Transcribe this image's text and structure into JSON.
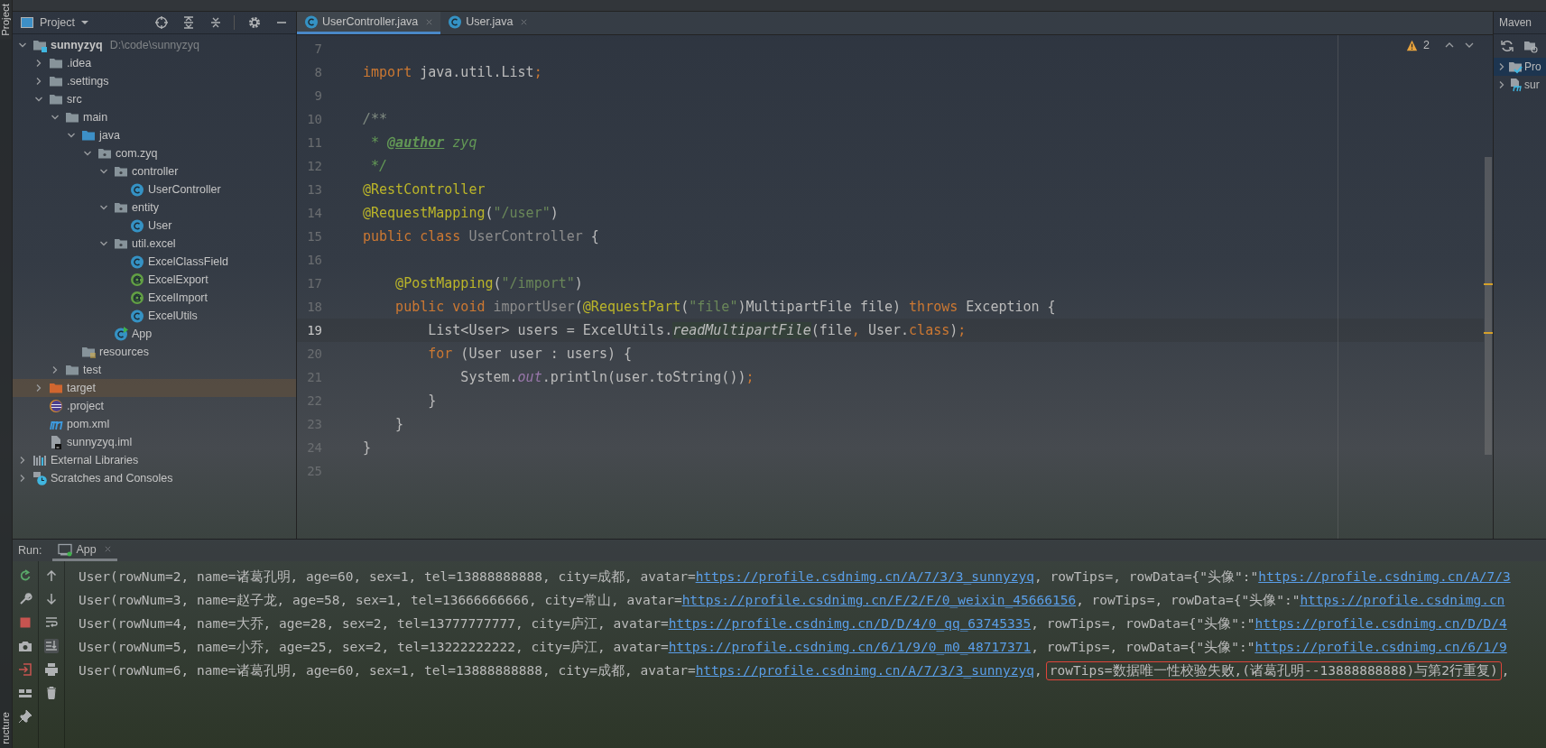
{
  "left_stripe": {
    "top_label": "Project",
    "bottom_label": "ructure"
  },
  "project": {
    "title": "Project",
    "tree": [
      {
        "label": "sunnyzyq",
        "path": "D:\\code\\sunnyzyq",
        "kind": "module",
        "expanded": true,
        "selected": false,
        "children": [
          {
            "label": ".idea",
            "kind": "folder",
            "expanded": false,
            "selected": false
          },
          {
            "label": ".settings",
            "kind": "folder",
            "expanded": false,
            "selected": false
          },
          {
            "label": "src",
            "kind": "folder",
            "expanded": true,
            "selected": false,
            "children": [
              {
                "label": "main",
                "kind": "folder",
                "expanded": true,
                "selected": false,
                "children": [
                  {
                    "label": "java",
                    "kind": "source-folder",
                    "expanded": true,
                    "selected": false,
                    "children": [
                      {
                        "label": "com.zyq",
                        "kind": "package",
                        "expanded": true,
                        "selected": false,
                        "children": [
                          {
                            "label": "controller",
                            "kind": "package",
                            "expanded": true,
                            "selected": false,
                            "children": [
                              {
                                "label": "UserController",
                                "kind": "class",
                                "selected": false
                              }
                            ]
                          },
                          {
                            "label": "entity",
                            "kind": "package",
                            "expanded": true,
                            "selected": false,
                            "children": [
                              {
                                "label": "User",
                                "kind": "class",
                                "selected": false
                              }
                            ]
                          },
                          {
                            "label": "util.excel",
                            "kind": "package",
                            "expanded": true,
                            "selected": false,
                            "children": [
                              {
                                "label": "ExcelClassField",
                                "kind": "class",
                                "selected": false
                              },
                              {
                                "label": "ExcelExport",
                                "kind": "annotation",
                                "selected": false
                              },
                              {
                                "label": "ExcelImport",
                                "kind": "annotation",
                                "selected": false
                              },
                              {
                                "label": "ExcelUtils",
                                "kind": "class",
                                "selected": false
                              }
                            ]
                          },
                          {
                            "label": "App",
                            "kind": "app-class",
                            "selected": false
                          }
                        ]
                      }
                    ]
                  },
                  {
                    "label": "resources",
                    "kind": "resources-folder",
                    "selected": false
                  }
                ]
              },
              {
                "label": "test",
                "kind": "folder",
                "expanded": false,
                "selected": false
              }
            ]
          },
          {
            "label": "target",
            "kind": "excluded-folder",
            "expanded": false,
            "selected": true
          },
          {
            "label": ".project",
            "kind": "eclipse",
            "selected": false
          },
          {
            "label": "pom.xml",
            "kind": "maven",
            "selected": false
          },
          {
            "label": "sunnyzyq.iml",
            "kind": "iml",
            "selected": false
          }
        ]
      },
      {
        "label": "External Libraries",
        "kind": "libraries",
        "expanded": false,
        "selected": false
      },
      {
        "label": "Scratches and Consoles",
        "kind": "scratches",
        "expanded": false,
        "selected": false
      }
    ]
  },
  "editor": {
    "tabs": [
      {
        "label": "UserController.java",
        "selected": true
      },
      {
        "label": "User.java",
        "selected": false
      }
    ],
    "warnings": "2",
    "lines": [
      {
        "number": "7",
        "current": false
      },
      {
        "number": "8",
        "current": false,
        "tokens": [
          {
            "kind": "kw",
            "text": "import"
          },
          {
            "kind": "plain",
            "text": " java.util.List"
          },
          {
            "kind": "kw",
            "text": ";"
          }
        ]
      },
      {
        "number": "9",
        "current": false
      },
      {
        "number": "10",
        "current": false,
        "tokens": [
          {
            "kind": "comment",
            "text": "/**"
          }
        ]
      },
      {
        "number": "11",
        "current": false,
        "tokens": [
          {
            "kind": "doc",
            "text": " * "
          },
          {
            "kind": "doctag",
            "text": "@author"
          },
          {
            "kind": "doc",
            "text": " zyq"
          }
        ]
      },
      {
        "number": "12",
        "current": false,
        "tokens": [
          {
            "kind": "doc",
            "text": " */"
          }
        ]
      },
      {
        "number": "13",
        "current": false,
        "tokens": [
          {
            "kind": "ann",
            "text": "@RestController"
          }
        ]
      },
      {
        "number": "14",
        "current": false,
        "tokens": [
          {
            "kind": "ann",
            "text": "@RequestMapping"
          },
          {
            "kind": "plain",
            "text": "("
          },
          {
            "kind": "str",
            "text": "\"/user\""
          },
          {
            "kind": "plain",
            "text": ")"
          }
        ]
      },
      {
        "number": "15",
        "current": false,
        "tokens": [
          {
            "kind": "kw",
            "text": "public class "
          },
          {
            "kind": "unused",
            "text": "UserController"
          },
          {
            "kind": "plain",
            "text": " {"
          }
        ]
      },
      {
        "number": "16",
        "current": false
      },
      {
        "number": "17",
        "current": false,
        "tokens": [
          {
            "kind": "ann",
            "text": "    @PostMapping"
          },
          {
            "kind": "plain",
            "text": "("
          },
          {
            "kind": "str",
            "text": "\"/import\""
          },
          {
            "kind": "plain",
            "text": ")"
          }
        ]
      },
      {
        "number": "18",
        "current": false,
        "tokens": [
          {
            "kind": "kw",
            "text": "    public void "
          },
          {
            "kind": "unused",
            "text": "importUser"
          },
          {
            "kind": "plain",
            "text": "("
          },
          {
            "kind": "ann",
            "text": "@RequestPart"
          },
          {
            "kind": "plain",
            "text": "("
          },
          {
            "kind": "str",
            "text": "\"file\""
          },
          {
            "kind": "plain",
            "text": ")MultipartFile file) "
          },
          {
            "kind": "kw",
            "text": "throws"
          },
          {
            "kind": "plain",
            "text": " Exception {"
          }
        ]
      },
      {
        "number": "19",
        "current": true,
        "tokens": [
          {
            "kind": "plain",
            "text": "        List<User> users = ExcelUtils."
          },
          {
            "kind": "static",
            "text": "readMultipartFile"
          },
          {
            "kind": "plain",
            "text": "(file"
          },
          {
            "kind": "kw",
            "text": ","
          },
          {
            "kind": "plain",
            "text": " User."
          },
          {
            "kind": "kw",
            "text": "class"
          },
          {
            "kind": "plain",
            "text": ")"
          },
          {
            "kind": "kw",
            "text": ";"
          }
        ]
      },
      {
        "number": "20",
        "current": false,
        "tokens": [
          {
            "kind": "kw",
            "text": "        for"
          },
          {
            "kind": "plain",
            "text": " (User user : users) {"
          }
        ]
      },
      {
        "number": "21",
        "current": false,
        "tokens": [
          {
            "kind": "plain",
            "text": "            System."
          },
          {
            "kind": "field",
            "text": "out"
          },
          {
            "kind": "plain",
            "text": ".println(user.toString())"
          },
          {
            "kind": "kw",
            "text": ";"
          }
        ]
      },
      {
        "number": "22",
        "current": false,
        "tokens": [
          {
            "kind": "plain",
            "text": "        }"
          }
        ]
      },
      {
        "number": "23",
        "current": false,
        "tokens": [
          {
            "kind": "plain",
            "text": "    }"
          }
        ]
      },
      {
        "number": "24",
        "current": false,
        "tokens": [
          {
            "kind": "plain",
            "text": "}"
          }
        ]
      },
      {
        "number": "25",
        "current": false
      }
    ]
  },
  "maven": {
    "title": "Maven",
    "rows": [
      {
        "label": "Pro",
        "kind": "profiles",
        "expanded": false,
        "selected": true
      },
      {
        "label": "sur",
        "kind": "maven-module",
        "expanded": false,
        "selected": false
      }
    ]
  },
  "run": {
    "label": "Run:",
    "tab": "App",
    "toolbar_left": [
      {
        "kind": "rerun",
        "on": false
      },
      {
        "kind": "wrench",
        "on": false
      },
      {
        "kind": "stop",
        "on": false
      },
      {
        "kind": "camera",
        "on": false
      },
      {
        "kind": "exit",
        "on": false
      },
      {
        "kind": "layout",
        "on": false
      },
      {
        "kind": "pin",
        "on": false
      }
    ],
    "toolbar_right": [
      {
        "kind": "up",
        "on": false
      },
      {
        "kind": "down",
        "on": false
      },
      {
        "kind": "wrap",
        "on": false
      },
      {
        "kind": "scroll-end",
        "on": true
      },
      {
        "kind": "print",
        "on": false
      },
      {
        "kind": "trash",
        "on": false
      }
    ],
    "console": [
      [
        {
          "kind": "text",
          "text": "User(rowNum=2, name=诸葛孔明, age=60, sex=1, tel=13888888888, city=成都, avatar="
        },
        {
          "kind": "link",
          "text": "https://profile.csdnimg.cn/A/7/3/3_sunnyzyq"
        },
        {
          "kind": "text",
          "text": ", rowTips=, rowData={\"头像\":\""
        },
        {
          "kind": "link",
          "text": "https://profile.csdnimg.cn/A/7/3"
        }
      ],
      [
        {
          "kind": "text",
          "text": "User(rowNum=3, name=赵子龙, age=58, sex=1, tel=13666666666, city=常山, avatar="
        },
        {
          "kind": "link",
          "text": "https://profile.csdnimg.cn/F/2/F/0_weixin_45666156"
        },
        {
          "kind": "text",
          "text": ", rowTips=, rowData={\"头像\":\""
        },
        {
          "kind": "link",
          "text": "https://profile.csdnimg.cn"
        }
      ],
      [
        {
          "kind": "text",
          "text": "User(rowNum=4, name=大乔, age=28, sex=2, tel=13777777777, city=庐江, avatar="
        },
        {
          "kind": "link",
          "text": "https://profile.csdnimg.cn/D/D/4/0_qq_63745335"
        },
        {
          "kind": "text",
          "text": ", rowTips=, rowData={\"头像\":\""
        },
        {
          "kind": "link",
          "text": "https://profile.csdnimg.cn/D/D/4"
        }
      ],
      [
        {
          "kind": "text",
          "text": "User(rowNum=5, name=小乔, age=25, sex=2, tel=13222222222, city=庐江, avatar="
        },
        {
          "kind": "link",
          "text": "https://profile.csdnimg.cn/6/1/9/0_m0_48717371"
        },
        {
          "kind": "text",
          "text": ", rowTips=, rowData={\"头像\":\""
        },
        {
          "kind": "link",
          "text": "https://profile.csdnimg.cn/6/1/9"
        }
      ],
      [
        {
          "kind": "text",
          "text": "User(rowNum=6, name=诸葛孔明, age=60, sex=1, tel=13888888888, city=成都, avatar="
        },
        {
          "kind": "link",
          "text": "https://profile.csdnimg.cn/A/7/3/3_sunnyzyq"
        },
        {
          "kind": "text",
          "text": ","
        },
        {
          "kind": "boxed",
          "text": "rowTips=数据唯一性校验失败,(诸葛孔明--13888888888)与第2行重复)"
        },
        {
          "kind": "text",
          "text": ","
        }
      ]
    ]
  }
}
